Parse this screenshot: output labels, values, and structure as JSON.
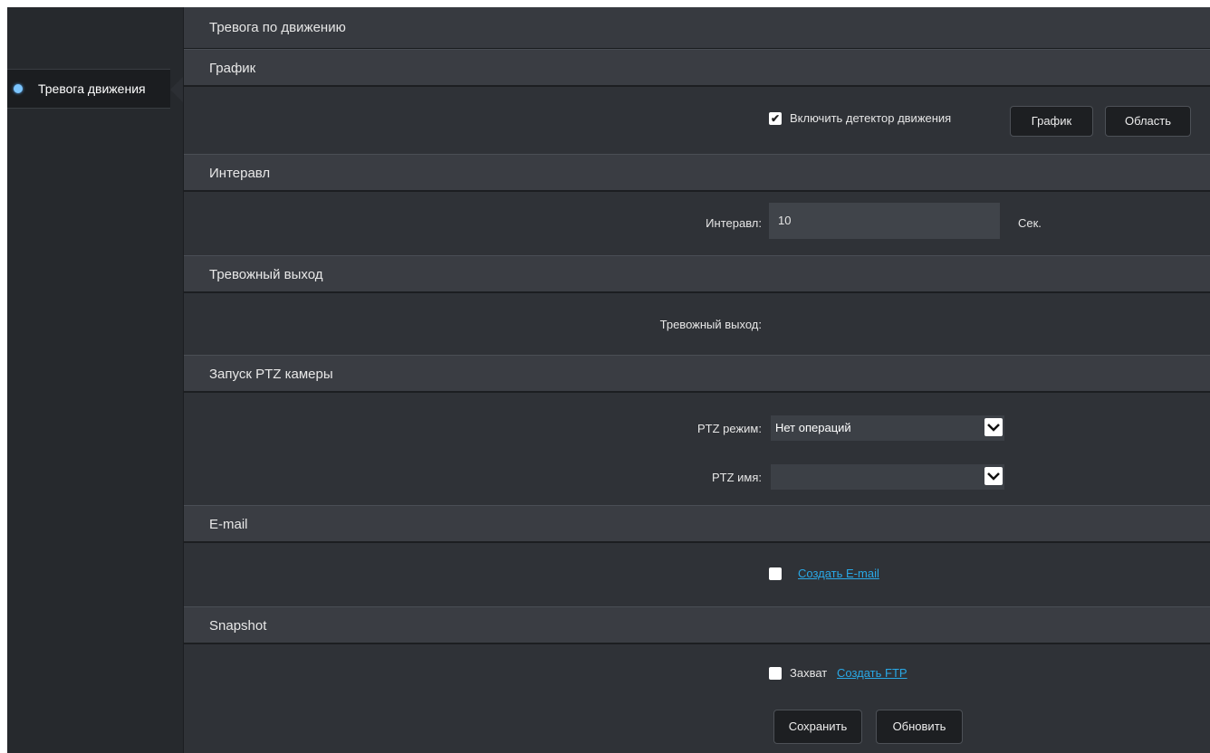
{
  "sidebar": {
    "items": [
      {
        "label": "Тревога движения",
        "active": true
      }
    ]
  },
  "page": {
    "title": "Тревога по движению"
  },
  "sections": {
    "schedule": {
      "header": "График",
      "enable_label": "Включить детектор движения",
      "enable_checked": true,
      "schedule_button": "График",
      "area_button": "Область"
    },
    "interval": {
      "header": "Интеравл",
      "label": "Интеравл:",
      "value": "10",
      "unit": "Сек."
    },
    "alarm_output": {
      "header": "Тревожный выход",
      "label": "Тревожный выход:"
    },
    "ptz": {
      "header": "Запуск PTZ камеры",
      "mode_label": "PTZ режим:",
      "mode_value": "Нет операций",
      "name_label": "PTZ имя:",
      "name_value": ""
    },
    "email": {
      "header": "E-mail",
      "checked": false,
      "create_link": "Создать E-mail"
    },
    "snapshot": {
      "header": "Snapshot",
      "capture_label": "Захват",
      "capture_checked": false,
      "create_ftp_link": "Создать FTP"
    }
  },
  "actions": {
    "save": "Сохранить",
    "refresh": "Обновить"
  },
  "colors": {
    "accent_link": "#29a8e6",
    "active_dot": "#7cc5ff"
  }
}
